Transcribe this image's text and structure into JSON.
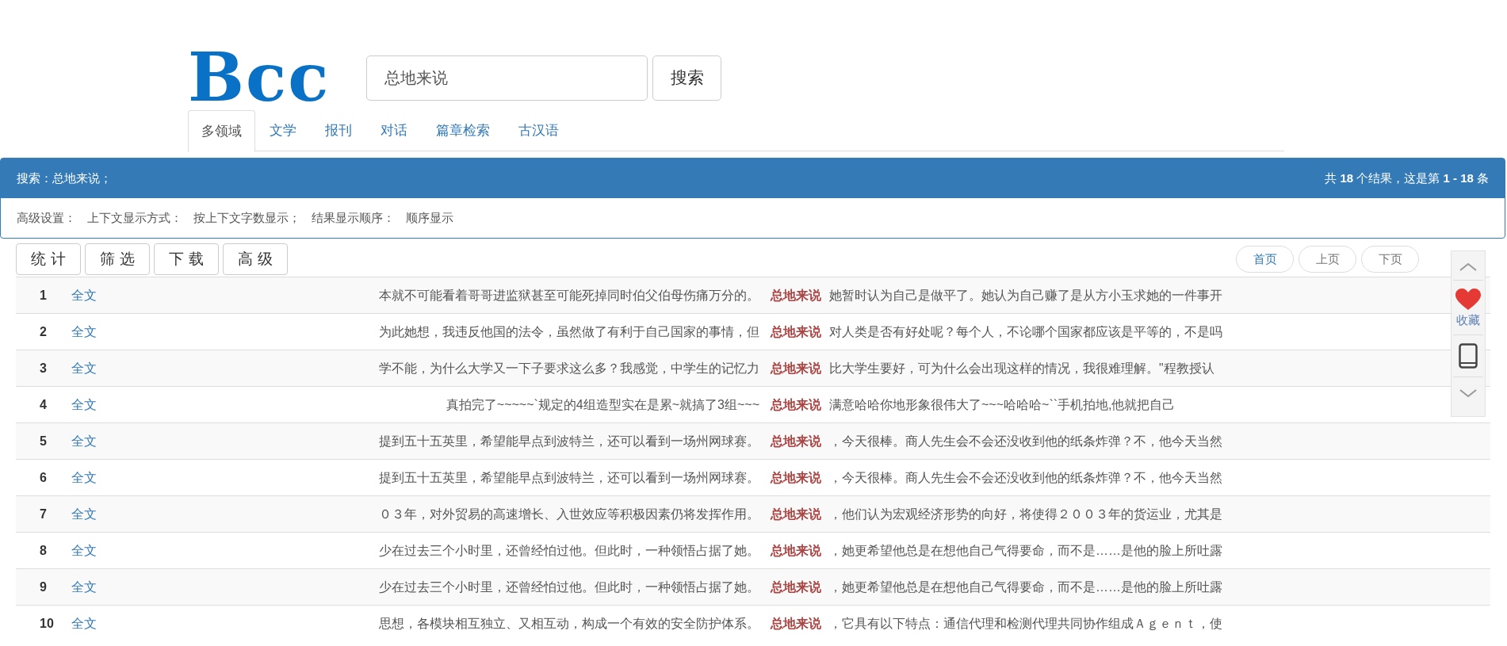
{
  "logo": {
    "text": "Bcc"
  },
  "search": {
    "value": "总地来说",
    "button": "搜索"
  },
  "tabs": [
    {
      "label": "多领域",
      "selected": true
    },
    {
      "label": "文学",
      "selected": false
    },
    {
      "label": "报刊",
      "selected": false
    },
    {
      "label": "对话",
      "selected": false
    },
    {
      "label": "篇章检索",
      "selected": false
    },
    {
      "label": "古汉语",
      "selected": false
    }
  ],
  "results_panel": {
    "query": "搜索：总地来说；",
    "summary": "共 **18** 个结果，这是第 **1 - 18** 条",
    "settings": [
      "高级设置：",
      "上下文显示方式：",
      "按上下文字数显示；",
      "结果显示顺序：",
      "顺序显示"
    ]
  },
  "tools": [
    "统计",
    "筛选",
    "下载",
    "高级"
  ],
  "pagination": [
    "首页",
    "上页",
    "下页"
  ],
  "rows": [
    {
      "number": "1",
      "link": "全文",
      "left": "本就不可能看着哥哥进监狱甚至可能死掉同时伯父伯母伤痛万分的。",
      "keyword": "总地来说",
      "right": "她暂时认为自己是做平了。她认为自己赚了是从方小玉求她的一件事开"
    },
    {
      "number": "2",
      "link": "全文",
      "left": "为此她想，我违反他国的法令，虽然做了有利于自己国家的事情，但",
      "keyword": "总地来说",
      "right": "对人类是否有好处呢？每个人，不论哪个国家都应该是平等的，不是吗"
    },
    {
      "number": "3",
      "link": "全文",
      "left": "学不能，为什么大学又一下子要求这么多？我感觉，中学生的记忆力",
      "keyword": "总地来说",
      "right": "比大学生要好，可为什么会出现这样的情况，我很难理解。\"程教授认"
    },
    {
      "number": "4",
      "link": "全文",
      "left": "真拍完了~~~~~`规定的4组造型实在是累~就搞了3组~~~",
      "keyword": "总地来说",
      "right": "满意哈哈你地形象很伟大了~~~哈哈哈~``手机拍地,他就把自己"
    },
    {
      "number": "5",
      "link": "全文",
      "left": "提到五十五英里，希望能早点到波特兰，还可以看到一场州网球赛。",
      "keyword": "总地来说",
      "right": "，今天很棒。商人先生会不会还没收到他的纸条炸弹？不，他今天当然"
    },
    {
      "number": "6",
      "link": "全文",
      "left": "提到五十五英里，希望能早点到波特兰，还可以看到一场州网球赛。",
      "keyword": "总地来说",
      "right": "，今天很棒。商人先生会不会还没收到他的纸条炸弹？不，他今天当然"
    },
    {
      "number": "7",
      "link": "全文",
      "left": "０３年，对外贸易的高速增长、入世效应等积极因素仍将发挥作用。",
      "keyword": "总地来说",
      "right": "，他们认为宏观经济形势的向好，将使得２００３年的货运业，尤其是"
    },
    {
      "number": "8",
      "link": "全文",
      "left": "少在过去三个小时里，还曾经怕过他。但此时，一种领悟占据了她。",
      "keyword": "总地来说",
      "right": "，她更希望他总是在想他自己气得要命，而不是……是他的脸上所吐露"
    },
    {
      "number": "9",
      "link": "全文",
      "left": "少在过去三个小时里，还曾经怕过他。但此时，一种领悟占据了她。",
      "keyword": "总地来说",
      "right": "，她更希望他总是在想他自己气得要命，而不是……是他的脸上所吐露"
    },
    {
      "number": "10",
      "link": "全文",
      "left": "思想，各模块相互独立、又相互动，构成一个有效的安全防护体系。",
      "keyword": "总地来说",
      "right": "，它具有以下特点：通信代理和检测代理共同协作组成Ａｇｅｎｔ，使"
    }
  ],
  "side_widget": {
    "favorite_label": "收藏"
  }
}
